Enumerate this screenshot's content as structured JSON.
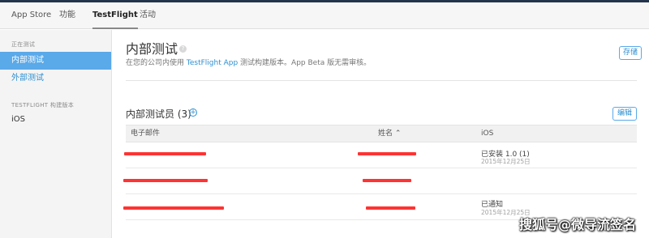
{
  "topnav": {
    "tabs": [
      {
        "label": "App Store"
      },
      {
        "label": "功能"
      },
      {
        "label": "TestFlight"
      },
      {
        "label": "活动"
      }
    ]
  },
  "sidebar": {
    "section_testing": "正在测试",
    "items": [
      {
        "label": "内部测试"
      },
      {
        "label": "外部测试"
      }
    ],
    "section_builds": "TESTFLIGHT 构建版本",
    "build_item": "iOS"
  },
  "page": {
    "title": "内部测试",
    "help_icon": "?",
    "desc_pre": "在您的公司内使用 ",
    "desc_link": "TestFlight App",
    "desc_post": " 测试构建版本。App Beta 版无需审核。",
    "save_label": "存储"
  },
  "testers": {
    "title": "内部测试员 (3)",
    "add_icon": "+",
    "edit_label": "编辑",
    "columns": {
      "email": "电子邮件",
      "name": "姓名 ⌃",
      "ios": "iOS"
    },
    "rows": [
      {
        "status": "已安装 1.0 (1)",
        "date": "2015年12月25日"
      },
      {
        "status": "",
        "date": ""
      },
      {
        "status": "已通知",
        "date": "2015年12月25日"
      }
    ]
  },
  "watermark": "搜狐号@微导流签名",
  "colors": {
    "accent": "#5aa9e9",
    "link": "#2d8fd0",
    "redaction": "#ff3333",
    "topbar": "#23344d"
  }
}
